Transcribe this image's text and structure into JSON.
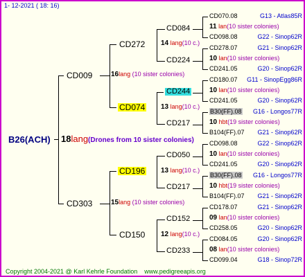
{
  "header_date": "1- 12-2021 ( 18: 16)",
  "copyright": "Copyright 2004-2021 @ Karl Kehrle Foundation",
  "website": "www.pedigreeapis.org",
  "root": {
    "name": "B26(ACH)",
    "count": "18",
    "lang": "lang",
    "note": "(Drones from 10 sister colonies)"
  },
  "gen1": [
    {
      "name": "CD009",
      "count": "16",
      "lang": "lang",
      "note": "(10 sister colonies)"
    },
    {
      "name": "CD303",
      "count": "15",
      "lang": "lang",
      "note": "(10 sister colonies)"
    }
  ],
  "gen2": [
    {
      "name": "CD272",
      "count": "14",
      "lang": "lang",
      "note": "(10 c.)"
    },
    {
      "name": "CD074",
      "count": "13",
      "lang": "lang",
      "note": "(10 c.)"
    },
    {
      "name": "CD196",
      "count": "13",
      "lang": "lang",
      "note": "(10 c.)"
    },
    {
      "name": "CD150",
      "count": "12",
      "lang": "lang",
      "note": "(10 c.)"
    }
  ],
  "gen3": [
    {
      "name": "CD084",
      "mid_count": "11",
      "mid_lang": "lan",
      "mid_note": "(10 sister colonies)",
      "top": {
        "name": "CD070.08",
        "loc": "G13 - Atlas85R"
      },
      "bottom": {
        "name": "CD098.08",
        "loc": "G22 - Sinop62R"
      }
    },
    {
      "name": "CD224",
      "mid_count": "10",
      "mid_lang": "lan",
      "mid_note": "(10 sister colonies)",
      "top": {
        "name": "CD278.07",
        "loc": "G21 - Sinop62R"
      },
      "bottom": {
        "name": "CD241.05",
        "loc": "G20 - Sinop62R"
      }
    },
    {
      "name": "CD244",
      "mid_count": "10",
      "mid_lang": "lan",
      "mid_note": "(10 sister colonies)",
      "top": {
        "name": "CD180.07",
        "loc": "G11 - SinopEgg86R"
      },
      "bottom": {
        "name": "CD241.05",
        "loc": "G20 - Sinop62R"
      }
    },
    {
      "name": "CD217",
      "mid_count": "10",
      "mid_lang": "hbt",
      "mid_note": "(19 sister colonies)",
      "top": {
        "name": "B30(FF).08",
        "loc": "G16 - Longos77R"
      },
      "bottom": {
        "name": "B104(FF).07",
        "loc": "G21 - Sinop62R"
      }
    },
    {
      "name": "CD050",
      "mid_count": "10",
      "mid_lang": "lan",
      "mid_note": "(10 sister colonies)",
      "top": {
        "name": "CD098.08",
        "loc": "G22 - Sinop62R"
      },
      "bottom": {
        "name": "CD241.05",
        "loc": "G20 - Sinop62R"
      }
    },
    {
      "name": "CD217",
      "mid_count": "10",
      "mid_lang": "hbt",
      "mid_note": "(19 sister colonies)",
      "top": {
        "name": "B30(FF).08",
        "loc": "G16 - Longos77R"
      },
      "bottom": {
        "name": "B104(FF).07",
        "loc": "G21 - Sinop62R"
      }
    },
    {
      "name": "CD152",
      "mid_count": "09",
      "mid_lang": "lan",
      "mid_note": "(10 sister colonies)",
      "top": {
        "name": "CD178.07",
        "loc": "G21 - Sinop62R"
      },
      "bottom": {
        "name": "CD258.05",
        "loc": "G20 - Sinop62R"
      }
    },
    {
      "name": "CD233",
      "mid_count": "08",
      "mid_lang": "lan",
      "mid_note": "(10 sister colonies)",
      "top": {
        "name": "CD084.05",
        "loc": "G20 - Sinop62R"
      },
      "bottom": {
        "name": "CD099.04",
        "loc": "G18 - Sinop72R"
      }
    }
  ],
  "colors": {
    "border": "#cc00cc",
    "lang": "#cc0000",
    "highlight_yellow": "#ffff00",
    "highlight_cyan": "#33dddd",
    "highlight_gray": "#c8c8c8",
    "location": "#0000cc",
    "copyright": "#007700"
  }
}
